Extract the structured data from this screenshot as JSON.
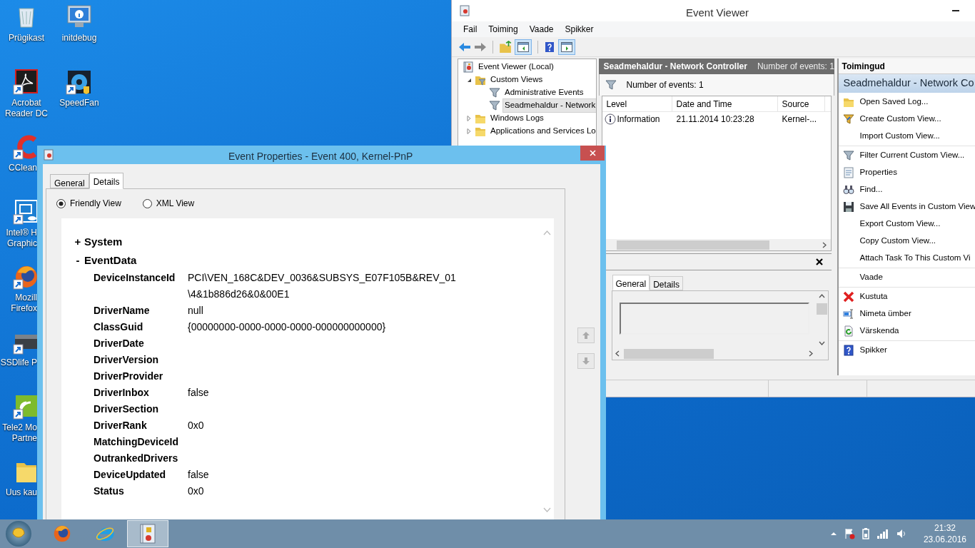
{
  "desktop_icons": [
    {
      "kind": "recycle-bin",
      "label": [
        "Prügikast"
      ],
      "shortcut": false
    },
    {
      "kind": "acrobat",
      "label": [
        "Acrobat",
        "Reader DC"
      ],
      "shortcut": true
    },
    {
      "kind": "ccleaner",
      "label": [
        "CClean"
      ],
      "shortcut": true
    },
    {
      "kind": "intel",
      "label": [
        "Intel® H",
        "Graphic"
      ],
      "shortcut": true
    },
    {
      "kind": "firefox",
      "label": [
        "Mozill",
        "Firefox"
      ],
      "shortcut": true
    },
    {
      "kind": "ssd",
      "label": [
        "SSDlife P"
      ],
      "shortcut": true
    },
    {
      "kind": "wireless",
      "label": [
        "Tele2 Mo",
        "Partne"
      ],
      "shortcut": true
    },
    {
      "kind": "folder",
      "label": [
        "Uus kau"
      ],
      "shortcut": false
    },
    {
      "kind": "info",
      "label": [
        "initdebug"
      ],
      "shortcut": false
    },
    {
      "kind": "fan",
      "label": [
        "SpeedFan"
      ],
      "shortcut": true
    }
  ],
  "event_viewer": {
    "title": "Event Viewer",
    "menu": [
      "Fail",
      "Toiming",
      "Vaade",
      "Spikker"
    ],
    "tree": [
      {
        "kind": "log",
        "label": "Event Viewer (Local)",
        "selected": false,
        "children": [
          {
            "kind": "filter-folder",
            "label": "Custom Views",
            "expanded": true,
            "selected": false,
            "children": [
              {
                "kind": "filter",
                "label": "Administrative Events",
                "selected": false
              },
              {
                "kind": "filter",
                "label": "Seadmehaldur - Network",
                "selected": true
              }
            ]
          },
          {
            "kind": "folder",
            "label": "Windows Logs",
            "expanded": false,
            "selected": false
          },
          {
            "kind": "folder",
            "label": "Applications and Services Lo",
            "expanded": false,
            "selected": false
          }
        ]
      }
    ],
    "view": {
      "title": "Seadmehaldur - Network Controller",
      "count": "Number of events: 1",
      "filter_text": "Number of events: 1",
      "columns": [
        "Level",
        "Date and Time",
        "Source"
      ],
      "rows": [
        {
          "level": "Information",
          "date_time": "21.11.2014 10:23:28",
          "source": "Kernel-...",
          "selected": false
        }
      ]
    },
    "preview_tabs": [
      {
        "label": "General",
        "selected": true
      },
      {
        "label": "Details",
        "selected": false
      }
    ],
    "actions": {
      "title": "Toimingud",
      "section": "Seadmehaldur - Network Co",
      "groups": [
        [
          {
            "kind": "open",
            "label": "Open Saved Log..."
          },
          {
            "kind": "create-filter",
            "label": "Create Custom View..."
          },
          {
            "kind": "plain",
            "label": "Import Custom View..."
          }
        ],
        [
          {
            "kind": "filter",
            "label": "Filter Current Custom View..."
          },
          {
            "kind": "properties",
            "label": "Properties"
          },
          {
            "kind": "find",
            "label": "Find..."
          },
          {
            "kind": "save",
            "label": "Save All Events in Custom View"
          },
          {
            "kind": "plain",
            "label": "Export Custom View..."
          },
          {
            "kind": "plain",
            "label": "Copy Custom View..."
          },
          {
            "kind": "plain",
            "label": "Attach Task To This Custom Vi"
          }
        ],
        [
          {
            "kind": "plain",
            "label": "Vaade"
          }
        ],
        [
          {
            "kind": "delete",
            "label": "Kustuta"
          },
          {
            "kind": "rename",
            "label": "Nimeta ümber"
          },
          {
            "kind": "refresh",
            "label": "Värskenda"
          }
        ],
        [
          {
            "kind": "help",
            "label": "Spikker"
          }
        ]
      ]
    }
  },
  "dialog": {
    "title": "Event Properties - Event 400, Kernel-PnP",
    "tabs": [
      {
        "label": "General",
        "selected": false
      },
      {
        "label": "Details",
        "selected": true
      }
    ],
    "view_options": [
      {
        "label": "Friendly View",
        "selected": true
      },
      {
        "label": "XML View",
        "selected": false
      }
    ],
    "sections": [
      {
        "toggle": "+",
        "label": "System"
      },
      {
        "toggle": "-",
        "label": "EventData",
        "fields": [
          {
            "name": "DeviceInstanceId",
            "value": [
              "PCI\\VEN_168C&DEV_0036&SUBSYS_E07F105B&REV_01",
              "\\4&1b886d26&0&00E1"
            ]
          },
          {
            "name": "DriverName",
            "value": [
              "null"
            ]
          },
          {
            "name": "ClassGuid",
            "value": [
              "{00000000-0000-0000-0000-000000000000}"
            ]
          },
          {
            "name": "DriverDate"
          },
          {
            "name": "DriverVersion"
          },
          {
            "name": "DriverProvider"
          },
          {
            "name": "DriverInbox",
            "value": [
              "false"
            ]
          },
          {
            "name": "DriverSection"
          },
          {
            "name": "DriverRank",
            "value": [
              "0x0"
            ]
          },
          {
            "name": "MatchingDeviceId"
          },
          {
            "name": "OutrankedDrivers"
          },
          {
            "name": "DeviceUpdated",
            "value": [
              "false"
            ]
          },
          {
            "name": "Status",
            "value": [
              "0x0"
            ]
          }
        ]
      }
    ]
  },
  "taskbar": {
    "apps": [
      {
        "kind": "firefox",
        "active": false
      },
      {
        "kind": "ie",
        "active": false
      },
      {
        "kind": "event-viewer",
        "active": true
      }
    ],
    "time": "21:32",
    "date": "23.06.2016"
  }
}
